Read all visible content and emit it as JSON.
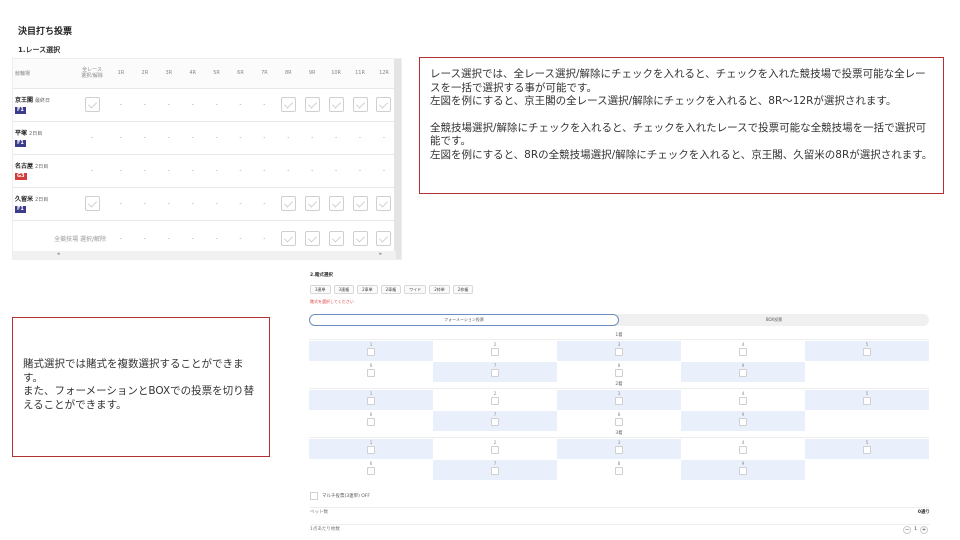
{
  "page": {
    "title": "決目打ち投票",
    "section": "1.レース選択"
  },
  "race_table": {
    "venue_header": "競輪場",
    "all_header_line1": "全レース",
    "all_header_line2": "選択/解除",
    "races": [
      "1R",
      "2R",
      "3R",
      "4R",
      "5R",
      "6R",
      "7R",
      "8R",
      "9R",
      "10R",
      "11R",
      "12R"
    ],
    "rows": [
      {
        "name": "京王閣",
        "day": "最終日",
        "grade": "F1",
        "all": "check",
        "cells": [
          "-",
          "-",
          "-",
          "-",
          "-",
          "-",
          "-",
          "check",
          "check",
          "check",
          "check",
          "check"
        ]
      },
      {
        "name": "平塚",
        "day": "2日目",
        "grade": "F1",
        "all": "-",
        "cells": [
          "-",
          "-",
          "-",
          "-",
          "-",
          "-",
          "-",
          "-",
          "-",
          "-",
          "-",
          "-"
        ]
      },
      {
        "name": "名古屋",
        "day": "2日目",
        "grade": "G3",
        "all": "-",
        "cells": [
          "-",
          "-",
          "-",
          "-",
          "-",
          "-",
          "-",
          "-",
          "-",
          "-",
          "-",
          "-"
        ]
      },
      {
        "name": "久留米",
        "day": "2日目",
        "grade": "F1",
        "all": "check",
        "cells": [
          "-",
          "-",
          "-",
          "-",
          "-",
          "-",
          "-",
          "check",
          "check",
          "check",
          "check",
          "check"
        ]
      }
    ],
    "all_venues_label": "全競技場 選択/解除",
    "all_venues_cells": [
      "-",
      "-",
      "-",
      "-",
      "-",
      "-",
      "-",
      "check",
      "check",
      "check",
      "check",
      "check"
    ],
    "scroll_left": "◂",
    "scroll_right": "▸"
  },
  "note_race": {
    "p1": "レース選択では、全レース選択/解除にチェックを入れると、チェックを入れた競技場で投票可能な全レースを一括で選択する事が可能です。",
    "p2": "左図を例にすると、京王閣の全レース選択/解除にチェックを入れると、8R～12Rが選択されます。",
    "p3": "全競技場選択/解除にチェックを入れると、チェックを入れたレースで投票可能な全競技場を一括で選択可能です。",
    "p4": "左図を例にすると、8Rの全競技場選択/解除にチェックを入れると、京王閣、久留米の8Rが選択されます。"
  },
  "note_bet": {
    "p1": "賭式選択では賭式を複数選択することができます。",
    "p2": "また、フォーメーションとBOXでの投票を切り替えることができます。"
  },
  "bet_panel": {
    "title": "2.賭式選択",
    "types": [
      "3連単",
      "3連複",
      "2車単",
      "2車複",
      "ワイド",
      "2枠単",
      "2枠複"
    ],
    "error": "賭式を選択してください",
    "mode_formation": "フォーメーション投票",
    "mode_box": "BOX投票",
    "places": [
      "1着",
      "2着",
      "3着"
    ],
    "numbers_row1": [
      "1",
      "2",
      "3",
      "4",
      "5"
    ],
    "numbers_row2": [
      "6",
      "7",
      "8",
      "9"
    ],
    "multi_label": "マルチ投票(3連単) OFF",
    "bet_count_label": "ベット数",
    "bet_count_value": "0通り",
    "unit_label": "1点あたり枚数",
    "unit_value": "1",
    "minus": "−",
    "plus": "+"
  }
}
